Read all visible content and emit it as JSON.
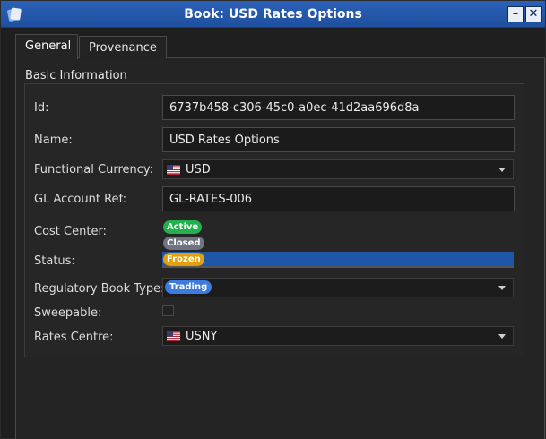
{
  "window": {
    "title": "Book: USD Rates Options",
    "minimize_glyph": "–",
    "close_glyph": "✕"
  },
  "tabs": [
    {
      "label": "General",
      "active": true
    },
    {
      "label": "Provenance",
      "active": false
    }
  ],
  "group": {
    "title": "Basic Information"
  },
  "fields": {
    "id": {
      "label": "Id:",
      "value": "6737b458-c306-45c0-a0ec-41d2aa696d8a"
    },
    "name": {
      "label": "Name:",
      "value": "USD Rates Options"
    },
    "functional_currency": {
      "label": "Functional Currency:",
      "value": "USD",
      "icon": "us-flag-icon"
    },
    "gl_account_ref": {
      "label": "GL Account Ref:",
      "value": "GL-RATES-006"
    },
    "cost_center": {
      "label": "Cost Center:"
    },
    "status": {
      "label": "Status:",
      "options": [
        {
          "label": "Active",
          "color": "#22b14c"
        },
        {
          "label": "Closed",
          "color": "#6e7480"
        },
        {
          "label": "Frozen",
          "color": "#e0a10c"
        }
      ],
      "selected": "Frozen",
      "highlight_color": "#1f57a8"
    },
    "regulatory_book_type": {
      "label": "Regulatory Book Type:",
      "value": "Trading",
      "color": "#3c7be0"
    },
    "sweepable": {
      "label": "Sweepable:",
      "checked": false
    },
    "rates_centre": {
      "label": "Rates Centre:",
      "value": "USNY",
      "icon": "us-flag-icon"
    }
  },
  "colors": {
    "titlebar": "#2c61b8",
    "background": "#1e1e1e"
  }
}
